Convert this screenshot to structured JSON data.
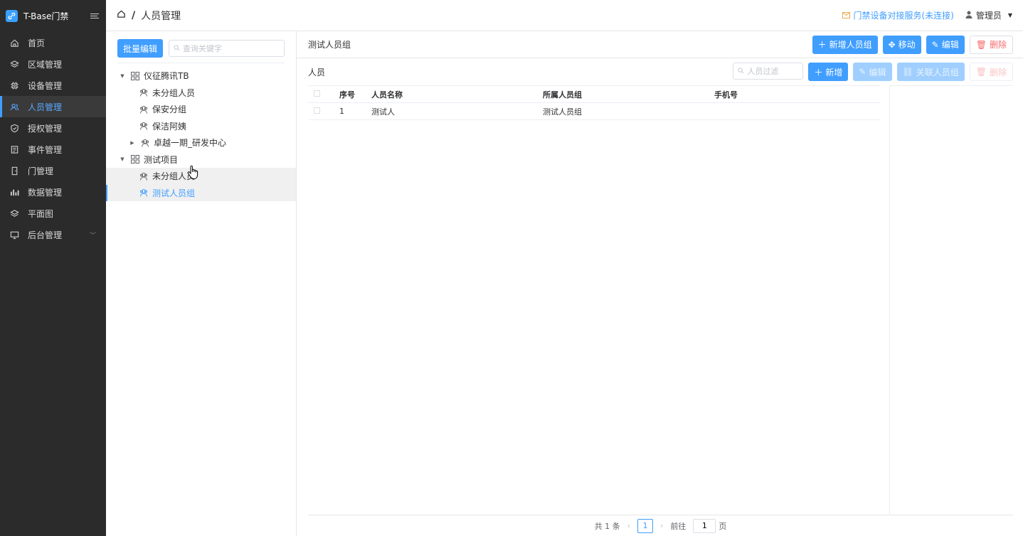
{
  "app": {
    "title": "T-Base门禁"
  },
  "sidebar": {
    "items": [
      {
        "label": "首页",
        "icon": "home-icon"
      },
      {
        "label": "区域管理",
        "icon": "layers-icon"
      },
      {
        "label": "设备管理",
        "icon": "chip-icon"
      },
      {
        "label": "人员管理",
        "icon": "users-icon"
      },
      {
        "label": "授权管理",
        "icon": "shield-icon"
      },
      {
        "label": "事件管理",
        "icon": "document-icon"
      },
      {
        "label": "门管理",
        "icon": "door-icon"
      },
      {
        "label": "数据管理",
        "icon": "bar-chart-icon"
      },
      {
        "label": "平面图",
        "icon": "layers-icon"
      },
      {
        "label": "后台管理",
        "icon": "monitor-icon"
      }
    ],
    "active_index": 3
  },
  "header": {
    "breadcrumb_page": "人员管理",
    "service_status": "门禁设备对接服务(未连接)",
    "user": "管理员"
  },
  "left": {
    "batch_edit": "批量编辑",
    "search_placeholder": "查询关键字",
    "tree": [
      {
        "label": "仪征腾讯TB",
        "level": 0,
        "expanded": true,
        "type": "group"
      },
      {
        "label": "未分组人员",
        "level": 1,
        "type": "people"
      },
      {
        "label": "保安分组",
        "level": 1,
        "type": "people"
      },
      {
        "label": "保洁阿姨",
        "level": 1,
        "type": "people"
      },
      {
        "label": "卓越一期_研发中心",
        "level": 1,
        "collapsed": true,
        "type": "people"
      },
      {
        "label": "测试项目",
        "level": 0,
        "expanded": true,
        "type": "group"
      },
      {
        "label": "未分组人员",
        "level": 1,
        "type": "people",
        "hover": true
      },
      {
        "label": "测试人员组",
        "level": 1,
        "type": "people",
        "selected": true
      }
    ]
  },
  "right": {
    "group_title": "测试人员组",
    "group_buttons": {
      "add": "新增人员组",
      "move": "移动",
      "edit": "编辑",
      "delete": "删除"
    },
    "people_title": "人员",
    "people_filter_placeholder": "人员过滤",
    "people_buttons": {
      "add": "新增",
      "edit": "编辑",
      "link": "关联人员组",
      "delete": "删除"
    },
    "table": {
      "columns": [
        "序号",
        "人员名称",
        "所属人员组",
        "手机号"
      ],
      "rows": [
        {
          "index": "1",
          "name": "测试人",
          "group": "测试人员组",
          "phone": ""
        }
      ]
    },
    "pager": {
      "total": "共 1 条",
      "current": "1",
      "goto_prefix": "前往",
      "goto_value": "1",
      "goto_suffix": "页"
    }
  },
  "colors": {
    "accent": "#409eff",
    "sidebar_bg": "#2b2b2b",
    "danger": "#f56c6c",
    "warning": "#e6a23c"
  }
}
